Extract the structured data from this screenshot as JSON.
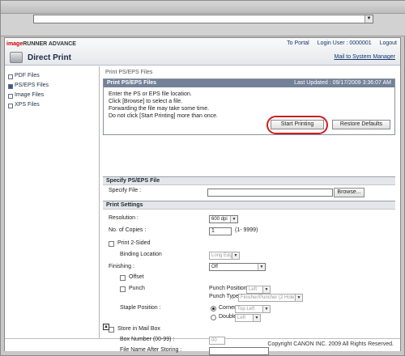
{
  "header": {
    "logo_prefix": "image",
    "logo_name": "RUNNER ADVANCE",
    "to_portal": "To Portal",
    "login_user": "Login User : 0000001",
    "logout": "Logout",
    "title": "Direct Print",
    "mail_link": "Mail to System Manager"
  },
  "sidebar": {
    "items": [
      {
        "label": "PDF Files",
        "active": false
      },
      {
        "label": "PS/EPS Files",
        "active": true
      },
      {
        "label": "Image Files",
        "active": false
      },
      {
        "label": "XPS Files",
        "active": false
      }
    ]
  },
  "main": {
    "breadcrumb": "Print PS/EPS Files",
    "panel": {
      "title": "Print PS/EPS Files",
      "last_updated": "Last Updated : 09/17/2009 3:36:07 AM",
      "lines": [
        "Enter the PS or EPS file location.",
        "Click [Browse] to select a file.",
        "Forwarding the file may take some time.",
        "Do not click [Start Printing] more than once."
      ],
      "start_button": "Start Printing",
      "restore_button": "Restore Defaults"
    },
    "file_section": {
      "title": "Specify PS/EPS File",
      "label": "Specify File :",
      "value": "",
      "browse": "Browse..."
    },
    "settings": {
      "title": "Print Settings",
      "resolution_label": "Resolution :",
      "resolution_value": "600 dpi",
      "copies_label": "No. of Copies :",
      "copies_value": "1",
      "copies_range": "(1- 9999)",
      "two_sided_label": "Print 2-Sided",
      "binding_label": "Binding Location",
      "binding_value": "Long Edge",
      "finishing_label": "Finishing :",
      "finishing_value": "Off",
      "offset_label": "Offset",
      "punch_label": "Punch",
      "punch_position_label": "Punch Position",
      "punch_position_value": "Left",
      "punch_type_label": "Punch Type",
      "punch_type_value": "Finisher/Puncher (2 Hole)",
      "staple_label": "Staple Position :",
      "corner_label": "Corner",
      "corner_value": "Top Left",
      "double_label": "Double",
      "double_value": "Left",
      "mailbox_label": "Store in Mail Box",
      "box_number_label": "Box Number (00-99) :",
      "box_number_value": "00",
      "file_name_label": "File Name After Storing :",
      "file_name_value": ""
    }
  },
  "footer": {
    "copyright": "Copyright CANON INC. 2009 All Rights Reserved."
  },
  "colors": {
    "panel_head": "#738199",
    "highlight_ring": "#cc1f22"
  }
}
